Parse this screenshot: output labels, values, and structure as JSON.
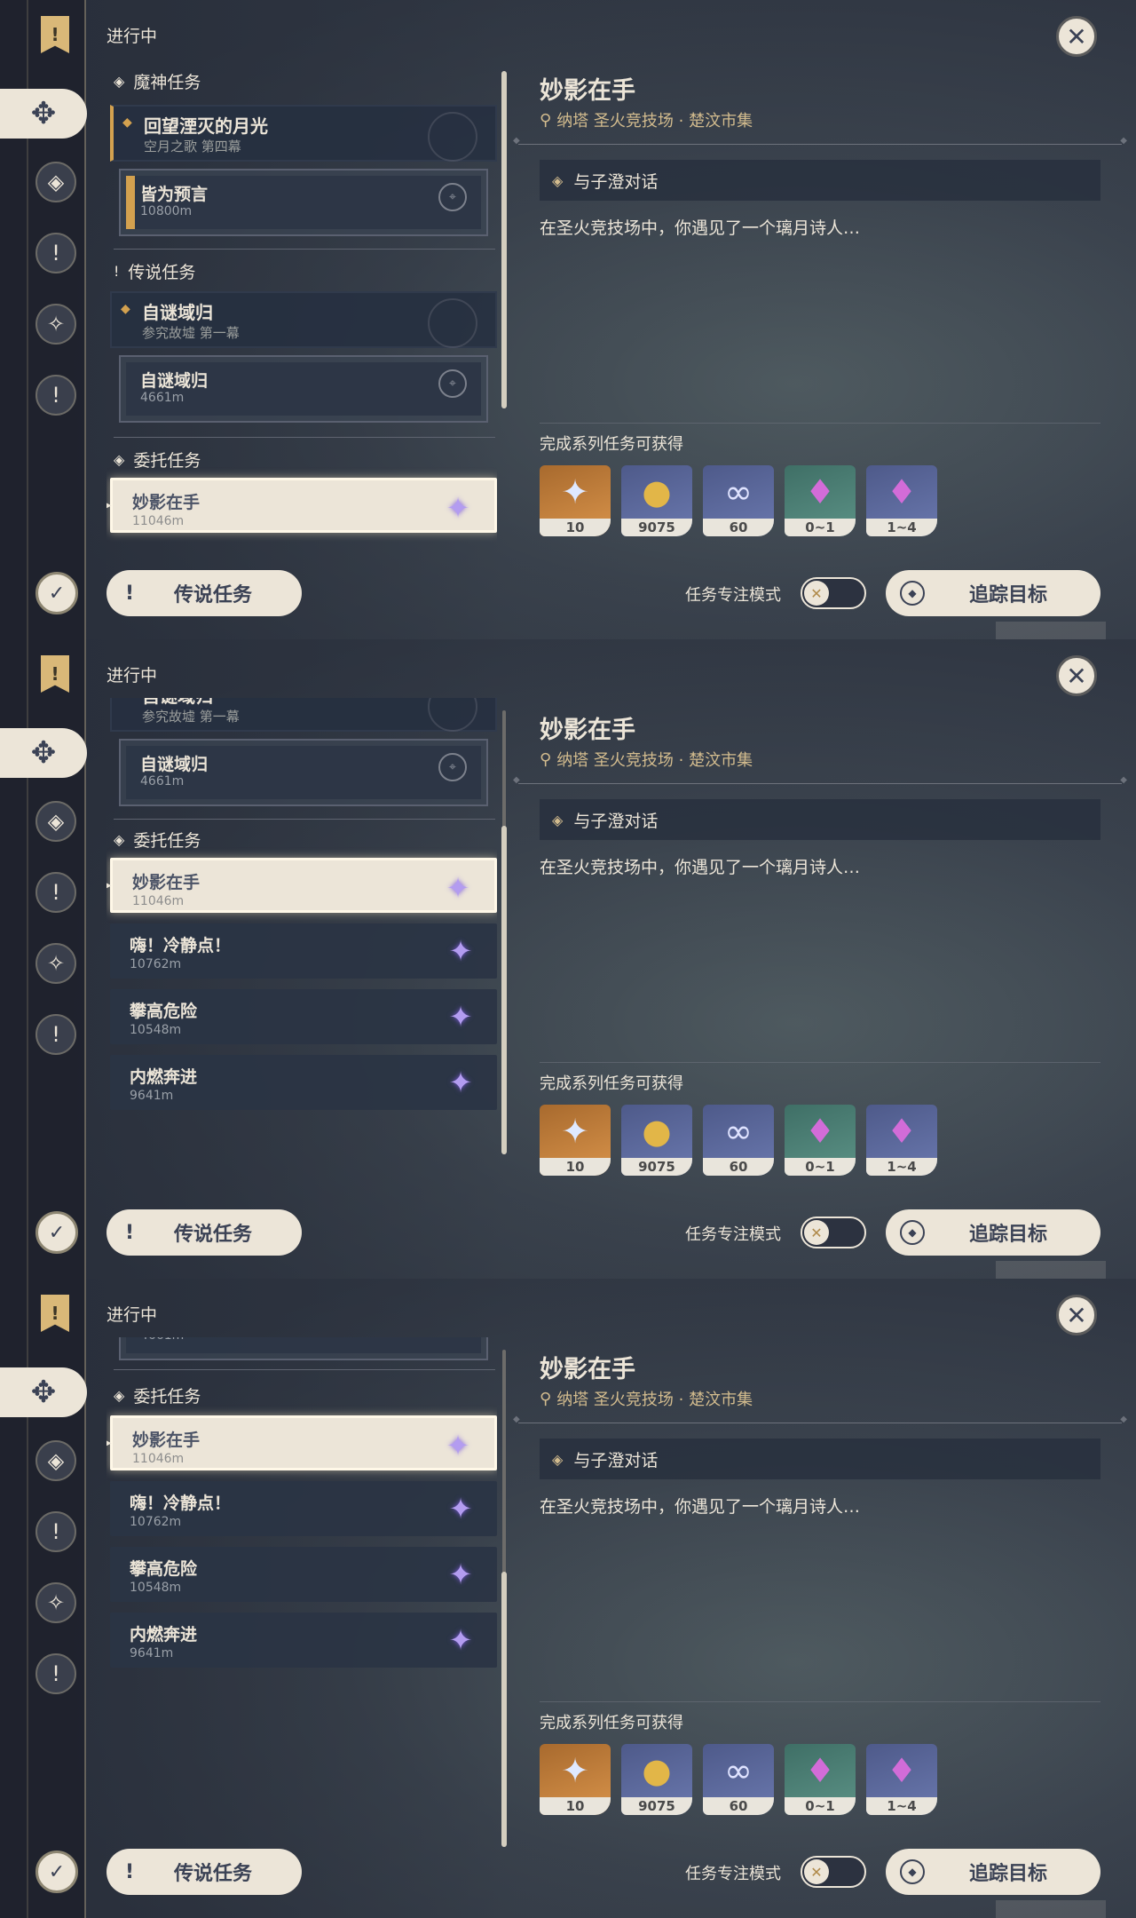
{
  "status_label": "进行中",
  "categories": {
    "archon": "魔神任务",
    "legend": "传说任务",
    "commission": "委托任务"
  },
  "archon_quest": {
    "title": "回望湮灭的月光",
    "subtitle": "空月之歌 第四幕",
    "step_title": "皆为预言",
    "step_distance": "10800m"
  },
  "legend_quest": {
    "title": "自谜域归",
    "subtitle": "参究故墟 第一幕",
    "step_title": "自谜域归",
    "step_distance": "4661m"
  },
  "commissions": [
    {
      "title": "妙影在手",
      "distance": "11046m"
    },
    {
      "title": "嗨！冷静点！",
      "distance": "10762m"
    },
    {
      "title": "攀高危险",
      "distance": "10548m"
    },
    {
      "title": "内燃奔进",
      "distance": "9641m"
    }
  ],
  "legend_button": "传说任务",
  "detail": {
    "title": "妙影在手",
    "location": "纳塔 圣火竞技场 · 楚汶市集",
    "objective": "与子澄对话",
    "description": "在圣火竞技场中，你遇见了一个璃月诗人…",
    "reward_label": "完成系列任务可获得",
    "rewards": [
      {
        "name": "primogem-icon",
        "count": "10"
      },
      {
        "name": "mora-icon",
        "count": "9075"
      },
      {
        "name": "adventure-exp-icon",
        "count": "60"
      },
      {
        "name": "crystal-ore-icon",
        "count": "0~1"
      },
      {
        "name": "crystal-cluster-icon",
        "count": "1~4"
      }
    ],
    "focus_label": "任务专注模式",
    "track_button": "追踪目标"
  },
  "colors": {
    "cream": "#ece5d8",
    "gold": "#d3a14f",
    "panel_dark": "#2a3444"
  }
}
